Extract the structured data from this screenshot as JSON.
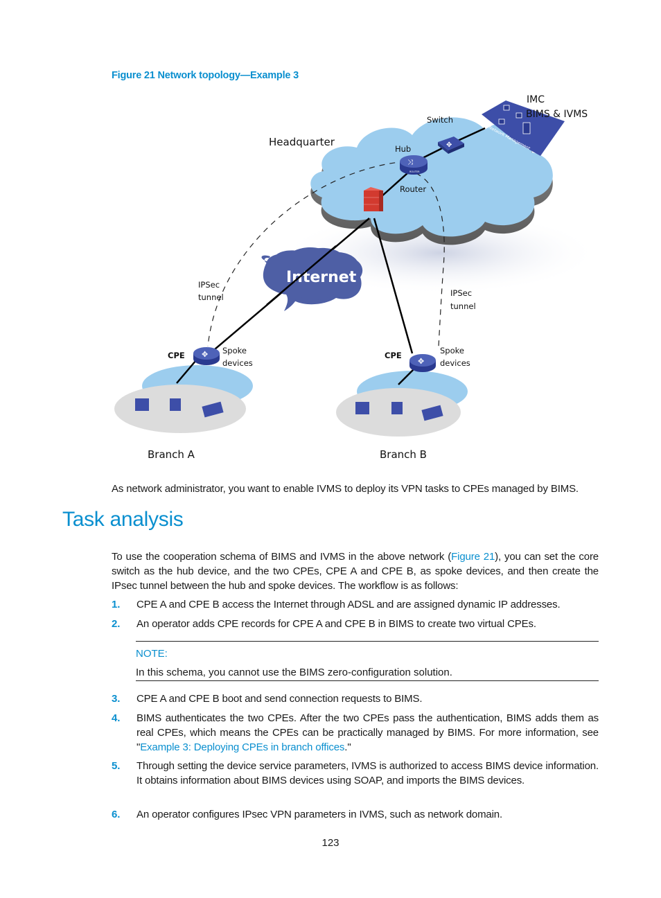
{
  "figure": {
    "caption": "Figure 21 Network topology—Example 3",
    "labels": {
      "headquarter": "Headquarter",
      "switch": "Switch",
      "hub": "Hub",
      "router": "Router",
      "imc": "IMC",
      "bims_ivms": "BIMS & IVMS",
      "network_management": "Network Management",
      "internet": "Internet",
      "ipsec_left_1": "IPSec",
      "ipsec_left_2": "tunnel",
      "ipsec_right_1": "IPSec",
      "ipsec_right_2": "tunnel",
      "cpe_a": "CPE",
      "cpe_b": "CPE",
      "spoke_a_1": "Spoke",
      "spoke_a_2": "devices",
      "spoke_b_1": "Spoke",
      "spoke_b_2": "devices",
      "branch_a": "Branch A",
      "branch_b": "Branch B",
      "router_badge": "ROUTER"
    },
    "colors": {
      "cloud": "#9ccdee",
      "device": "#3d4ea8",
      "internet_cloud": "#4e5fa5",
      "firewall": "#d23a2f",
      "lan_ellipse": "#dcdcdc"
    }
  },
  "intro": "As network administrator, you want to enable IVMS to deploy its VPN tasks to CPEs managed by BIMS.",
  "section": {
    "heading": "Task analysis",
    "paragraph_before": "To use the cooperation schema of BIMS and IVMS in the above network (",
    "paragraph_link": "Figure 21",
    "paragraph_after": "), you can set the core switch as the hub device, and the two CPEs, CPE A and CPE B, as spoke devices, and then create the IPsec tunnel between the hub and spoke devices. The workflow is as follows:",
    "steps": [
      {
        "num": "1.",
        "text": "CPE A and CPE B access the Internet through ADSL and are assigned dynamic IP addresses."
      },
      {
        "num": "2.",
        "text": "An operator adds CPE records for CPE A and CPE B in BIMS to create two virtual CPEs."
      },
      {
        "num": "3.",
        "text": "CPE A and CPE B boot and send connection requests to BIMS."
      },
      {
        "num": "4.",
        "text_before": "BIMS authenticates the two CPEs. After the two CPEs pass the authentication, BIMS adds them as real CPEs, which means the CPEs can be practically managed by BIMS. For more information, see \"",
        "link": "Example 3: Deploying CPEs in branch offices",
        "text_after": ".\""
      },
      {
        "num": "5.",
        "text": "Through setting the device service parameters, IVMS is authorized to access BIMS device information. It obtains information about BIMS devices using SOAP, and imports the BIMS devices."
      },
      {
        "num": "6.",
        "text": "An operator configures IPsec VPN parameters in IVMS, such as network domain."
      }
    ],
    "note": {
      "label": "NOTE:",
      "text": "In this schema, you cannot use the BIMS zero-configuration solution."
    }
  },
  "page_number": "123"
}
